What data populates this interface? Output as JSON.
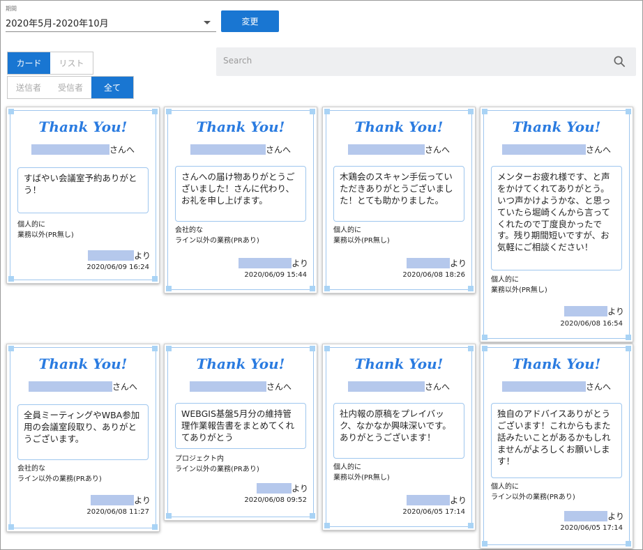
{
  "period": {
    "label": "期間",
    "value": "2020年5月-2020年10月"
  },
  "change_button": {
    "label": "変更"
  },
  "view_toggle": {
    "card": "カード",
    "list": "リスト",
    "active": "card"
  },
  "direction_filter": {
    "sent": "送信者",
    "received": "受信者",
    "all": "全て",
    "active": "all"
  },
  "search": {
    "placeholder": "Search"
  },
  "colors": {
    "primary": "#1976d2",
    "thank_you": "#2a7be0",
    "card_border": "#9ec6ee",
    "redaction": "#b5c8ec"
  },
  "cards": [
    {
      "heading": "Thank You!",
      "recipient_suffix": "さんへ",
      "message": "すばやい会議室予約ありがとう！",
      "category": [
        "個人的に",
        "業務以外(PR無し)"
      ],
      "sender_suffix": "より",
      "date": "2020/06/09 16:24"
    },
    {
      "heading": "Thank You!",
      "recipient_suffix": "さんへ",
      "message": "さんへの届け物ありがとうございました！さんに代わり、お礼を申し上げます。",
      "category": [
        "会社的な",
        "ライン以外の業務(PRあり)"
      ],
      "sender_suffix": "より",
      "date": "2020/06/09 15:44"
    },
    {
      "heading": "Thank You!",
      "recipient_suffix": "さんへ",
      "message": "木鶏会のスキャン手伝っていただきありがとうございました！とても助かりました。",
      "category": [
        "個人的に",
        "業務以外(PR無し)"
      ],
      "sender_suffix": "より",
      "date": "2020/06/08 18:26"
    },
    {
      "heading": "Thank You!",
      "recipient_suffix": "さんへ",
      "message": "メンターお疲れ様です、と声をかけてくれてありがとう。いつ声かけようかな、と思っていたら堀崎くんから言ってくれたので丁度良かったです。残り期間短いですが、お気軽にご相談ください！",
      "category": [
        "個人的に",
        "業務以外(PR無し)"
      ],
      "sender_suffix": "より",
      "date": "2020/06/08 16:54"
    },
    {
      "heading": "Thank You!",
      "recipient_suffix": "さんへ",
      "message": "全員ミーティングやWBA参加用の会議室段取り、ありがとうございます。",
      "category": [
        "会社的な",
        "ライン以外の業務(PRあり)"
      ],
      "sender_suffix": "より",
      "date": "2020/06/08 11:27"
    },
    {
      "heading": "Thank You!",
      "recipient_suffix": "さんへ",
      "message": "WEBGIS基盤5月分の維持管理作業報告書をまとめてくれてありがとう",
      "category": [
        "プロジェクト内",
        "ライン以外の業務(PRあり)"
      ],
      "sender_suffix": "より",
      "date": "2020/06/08 09:52"
    },
    {
      "heading": "Thank You!",
      "recipient_suffix": "さんへ",
      "message": "社内報の原稿をプレイバック、なかなか興味深いです。ありがとうございます！",
      "category": [
        "個人的に",
        "業務以外(PR無し)"
      ],
      "sender_suffix": "より",
      "date": "2020/06/05 17:14"
    },
    {
      "heading": "Thank You!",
      "recipient_suffix": "さんへ",
      "message": "独自のアドバイスありがとうございます！これからもまた話みたいことがあるかもしれませんがよろしくお願いします！",
      "category": [
        "個人的に",
        "ライン以外の業務(PRあり)"
      ],
      "sender_suffix": "より",
      "date": "2020/06/05 17:14"
    }
  ]
}
